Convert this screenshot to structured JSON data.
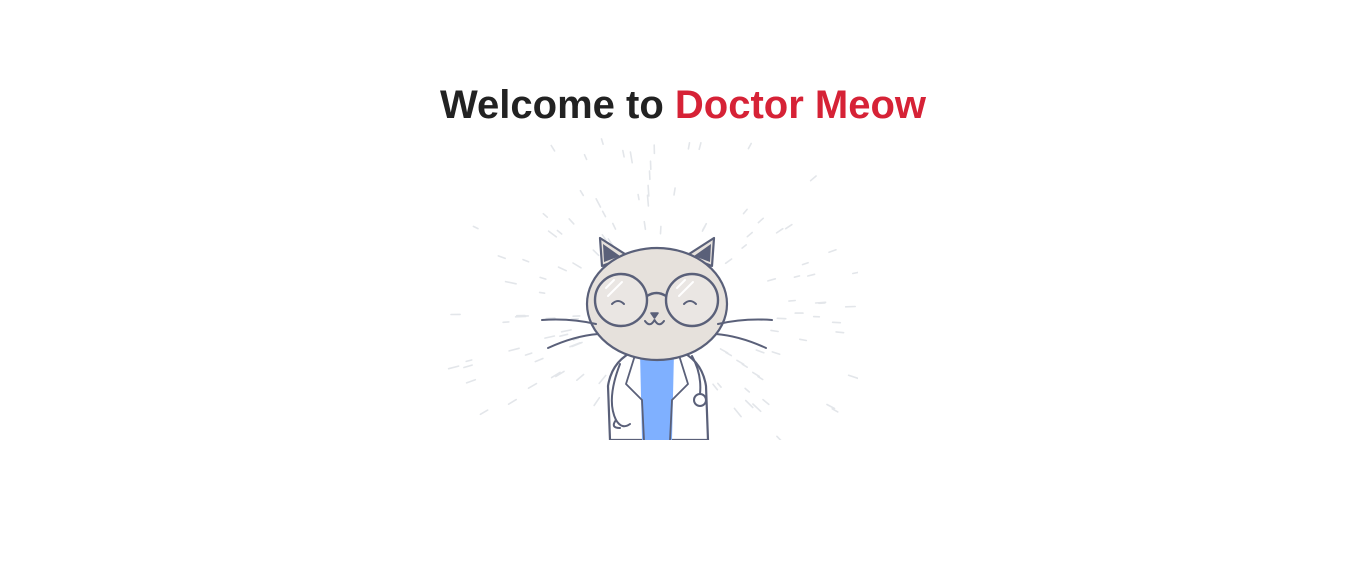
{
  "heading": {
    "prefix": "Welcome to ",
    "brand": "Doctor Meow"
  },
  "colors": {
    "brand": "#d62236",
    "text": "#222222",
    "outline": "#5a6079",
    "fur": "#e6e1dc",
    "scrubs": "#7fb0ff"
  },
  "illustration": {
    "icon": "doctor-cat-icon"
  }
}
